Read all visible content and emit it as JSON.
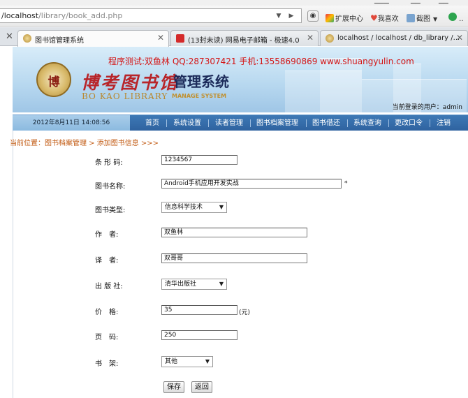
{
  "browser": {
    "url_host": "/localhost",
    "url_path": "/library/book_add.php",
    "toolbar": {
      "extensions": "扩展中心",
      "favorites": "我喜欢",
      "screenshot": "截图"
    },
    "tabs": [
      {
        "label": "图书馆管理系统",
        "active": true
      },
      {
        "label": "(13封未读) 网易电子邮箱 - 极速4.0",
        "active": false
      },
      {
        "label": "localhost / localhost / db_library /...",
        "active": false
      }
    ]
  },
  "header": {
    "test_info": "程序测试:双鱼林 QQ:287307421 手机:13558690869 www.shuangyulin.com",
    "logo_emblem": "博",
    "logo_cn": "博考图书馆",
    "logo_en": "BO KAO LIBRARY",
    "logo_sub": "MANAGE SYSTEM",
    "system_title": "管理系统",
    "current_user": "当前登录的用户：admin"
  },
  "nav": {
    "datetime": "2012年8月11日  14:08:56",
    "items": [
      "首页",
      "系统设置",
      "读者管理",
      "图书档案管理",
      "图书借还",
      "系统查询",
      "更改口令",
      "注销"
    ]
  },
  "breadcrumb": "当前位置：图书档案管理 > 添加图书信息 >>>",
  "form": {
    "barcode": {
      "label": "条 形 码:",
      "value": "1234567"
    },
    "book_name": {
      "label": "图书名称:",
      "value": "Android手机应用开发实战",
      "required": "*"
    },
    "book_type": {
      "label": "图书类型:",
      "value": "信息科学技术"
    },
    "author": {
      "label": "作　者:",
      "value": "双鱼林"
    },
    "translator": {
      "label": "译　者:",
      "value": "双哥哥"
    },
    "publisher": {
      "label": "出 版 社:",
      "value": "清华出版社"
    },
    "price": {
      "label": "价　格:",
      "value": "35",
      "unit": "(元)"
    },
    "pages": {
      "label": "页　码:",
      "value": "250"
    },
    "shelf": {
      "label": "书　架:",
      "value": "其他"
    },
    "save_button": "保存",
    "back_button": "返回"
  },
  "colors": {
    "nav_bg": "#3169a7",
    "banner_bg": "#b9d9f0",
    "breadcrumb": "#c25a12",
    "test_info": "#d41414"
  }
}
